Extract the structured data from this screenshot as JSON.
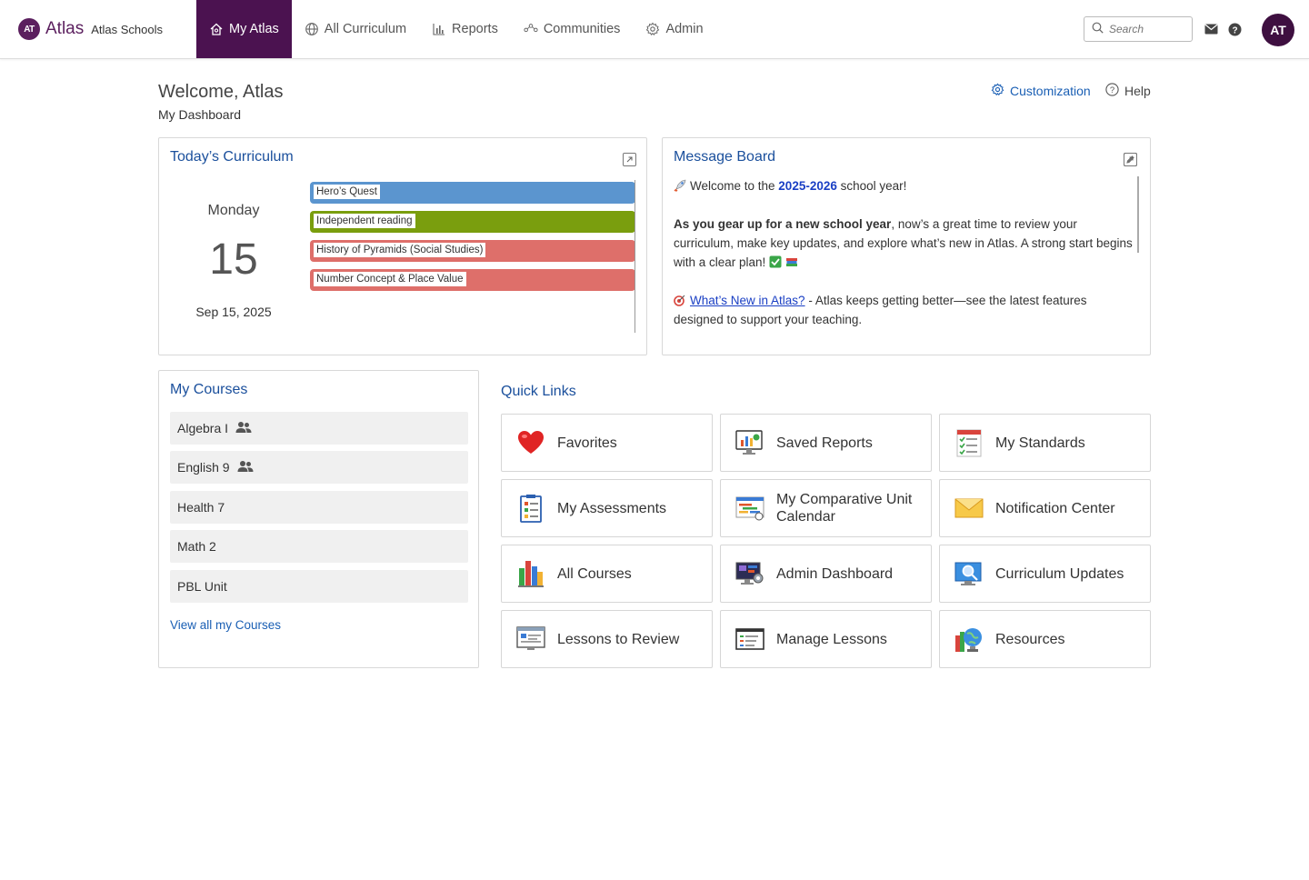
{
  "brand": {
    "logo_text": "AT",
    "name": "Atlas",
    "school": "Atlas Schools"
  },
  "nav": {
    "items": [
      {
        "label": "My Atlas",
        "icon": "home-icon"
      },
      {
        "label": "All Curriculum",
        "icon": "globe-icon"
      },
      {
        "label": "Reports",
        "icon": "bar-chart-icon"
      },
      {
        "label": "Communities",
        "icon": "network-icon"
      },
      {
        "label": "Admin",
        "icon": "gear-icon"
      }
    ],
    "search_placeholder": "Search",
    "avatar_initials": "AT"
  },
  "header": {
    "welcome": "Welcome, Atlas",
    "subtitle": "My Dashboard",
    "customization": "Customization",
    "help": "Help"
  },
  "today": {
    "title": "Today’s Curriculum",
    "day_name": "Monday",
    "day_num": "15",
    "date": "Sep 15, 2025",
    "lessons": [
      {
        "label": "Hero’s Quest",
        "color": "#5b95cf"
      },
      {
        "label": "Independent reading",
        "color": "#7a9e0e"
      },
      {
        "label": "History of Pyramids (Social Studies)",
        "color": "#de6f6a"
      },
      {
        "label": "Number Concept & Place Value",
        "color": "#de6f6a"
      }
    ]
  },
  "message_board": {
    "title": "Message Board",
    "line1_pre": "Welcome to the ",
    "line1_year": "2025-2026",
    "line1_post": " school year!",
    "p2_bold": "As you gear up for a new school year",
    "p2_rest": ", now’s a great time to review your curriculum, make key updates, and explore what’s new in Atlas. A strong start begins with a clear plan!",
    "link": "What’s New in Atlas?",
    "p3_rest": " - Atlas keeps getting better—see the latest features designed to support your teaching."
  },
  "courses": {
    "title": "My Courses",
    "items": [
      {
        "label": "Algebra I",
        "shared": true
      },
      {
        "label": "English 9",
        "shared": true
      },
      {
        "label": "Health 7",
        "shared": false
      },
      {
        "label": "Math 2",
        "shared": false
      },
      {
        "label": "PBL Unit",
        "shared": false
      }
    ],
    "view_all": "View all my Courses"
  },
  "quick_links": {
    "title": "Quick Links",
    "items": [
      {
        "label": "Favorites",
        "icon": "heart-icon"
      },
      {
        "label": "Saved Reports",
        "icon": "saved-reports-icon"
      },
      {
        "label": "My Standards",
        "icon": "standards-checklist-icon"
      },
      {
        "label": "My Assessments",
        "icon": "assessment-clipboard-icon"
      },
      {
        "label": "My Comparative Unit Calendar",
        "icon": "calendar-chart-icon"
      },
      {
        "label": "Notification Center",
        "icon": "envelope-icon"
      },
      {
        "label": "All Courses",
        "icon": "books-icon"
      },
      {
        "label": "Admin Dashboard",
        "icon": "admin-monitor-icon"
      },
      {
        "label": "Curriculum Updates",
        "icon": "magnifier-monitor-icon"
      },
      {
        "label": "Lessons to Review",
        "icon": "lesson-screen-icon"
      },
      {
        "label": "Manage Lessons",
        "icon": "manage-lessons-icon"
      },
      {
        "label": "Resources",
        "icon": "globe-resources-icon"
      }
    ]
  }
}
